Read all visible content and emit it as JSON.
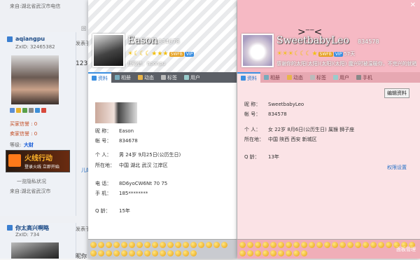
{
  "forum": {
    "top_location": "来自:湖北省武汉市电信",
    "user1": {
      "name": "aqiangpu",
      "uid": "ZxID:  32465382",
      "buy_credit": "买家信誉 : 0",
      "sell_credit": "卖家信誉 : 0",
      "level_label": "等级:",
      "level_value": "大财",
      "ad_text": "火线行动",
      "ad_sub": "登录火线 立即开始",
      "location": "来自:湖北省武汉市",
      "view_text": "一览隐私状况"
    },
    "user2": {
      "name": "你太高兴啊略",
      "uid": "ZxID:  734"
    },
    "post_label_1": "发表于",
    "post_label_2": "发表于",
    "post_text_1": "123",
    "post_text_2": "昵你",
    "reply_label": "回",
    "jump_label": "儿的"
  },
  "left_card": {
    "nickname": "Eason",
    "qq": "834678",
    "signature": "加微信：hoonpu",
    "badge1": "SWFB",
    "badge2": "VIP",
    "tabs": [
      "资料",
      "相册",
      "动态",
      "标签",
      "用户"
    ],
    "fields": [
      {
        "label": "昵  称：",
        "value": "Eason"
      },
      {
        "label": "帐  号：",
        "value": "834678"
      },
      {
        "label": "个  人：",
        "value": "男   24岁   9月25日(公历生日)"
      },
      {
        "label": "所在地：",
        "value": "中国 湖北 武汉 江岸区"
      },
      {
        "label": "电  话：",
        "value": "8D6yoCW6Nt 70 75"
      },
      {
        "label": "手  机：",
        "value": "185********"
      },
      {
        "label": "Q    龄：",
        "value": "15年"
      }
    ]
  },
  "right_card": {
    "nickname": "SweetbabyLeo",
    "qq": "834578",
    "signature": "感谢你的太阳(太阳)(太阳)(太阳)        魔兴时被温暖你，不完兴的就晒...",
    "badge1": "SWFB",
    "badge2": "VIP",
    "days": "57天",
    "tabs": [
      "资料",
      "相册",
      "动态",
      "标签",
      "用户",
      "手机"
    ],
    "edit_button": "编辑资料",
    "fields": [
      {
        "label": "昵  称：",
        "value": "SweetbabyLeo"
      },
      {
        "label": "帐  号：",
        "value": "834578"
      },
      {
        "label": "个  人：",
        "value": "女   22岁   8月6日(公历生日)   属猴   狮子座"
      },
      {
        "label": "所在地：",
        "value": "中国 陕西 西安 新城区"
      },
      {
        "label": "Q    龄：",
        "value": "13年"
      }
    ],
    "privacy_link": "权限设置",
    "emoji_manage": "面板管理"
  },
  "colors": {
    "accent": "#2a72c8",
    "pink": "#f6b9c4",
    "tabdark": "#5b5f66"
  }
}
